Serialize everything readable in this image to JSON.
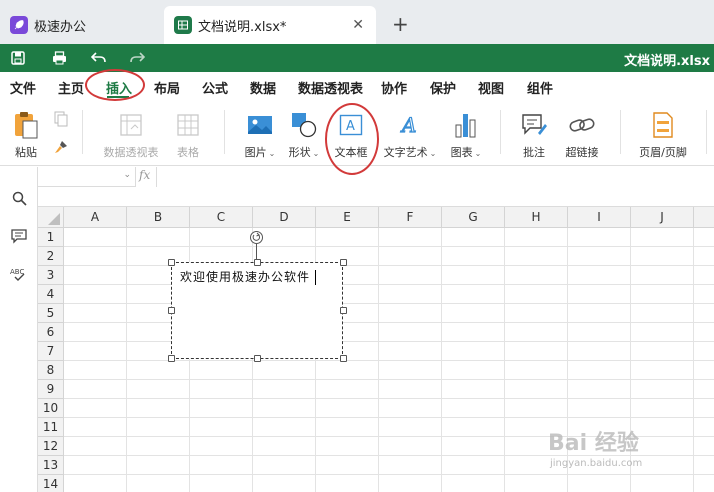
{
  "tabs": [
    {
      "label": "极速办公"
    },
    {
      "label": "文档说明.xlsx*"
    }
  ],
  "title_bar": {
    "document_title": "文档说明.xlsx"
  },
  "menu": {
    "items": [
      "文件",
      "主页",
      "插入",
      "布局",
      "公式",
      "数据",
      "数据透视表",
      "协作",
      "保护",
      "视图",
      "组件"
    ],
    "active": "插入"
  },
  "ribbon": {
    "paste": "粘贴",
    "pivot_table": "数据透视表",
    "table": "表格",
    "picture": "图片",
    "shape": "形状",
    "textbox": "文本框",
    "wordart": "文字艺术",
    "chart": "图表",
    "comment": "批注",
    "hyperlink": "超链接",
    "header_footer": "页眉/页脚"
  },
  "formula_bar": {
    "fx": "fx",
    "name_box": "",
    "formula": ""
  },
  "sheet": {
    "columns": [
      "A",
      "B",
      "C",
      "D",
      "E",
      "F",
      "G",
      "H",
      "I",
      "J"
    ],
    "rows": [
      "1",
      "2",
      "3",
      "4",
      "5",
      "6",
      "7",
      "8",
      "9",
      "10",
      "11",
      "12",
      "13",
      "14"
    ]
  },
  "textbox": {
    "text": "欢迎使用极速办公软件"
  },
  "colors": {
    "brand_green": "#1e7b45",
    "highlight_red": "#d23a3a",
    "app_icon_purple": "#7a49d9"
  },
  "watermark": {
    "brand": "Bai 经验",
    "url": "jingyan.baidu.com"
  }
}
